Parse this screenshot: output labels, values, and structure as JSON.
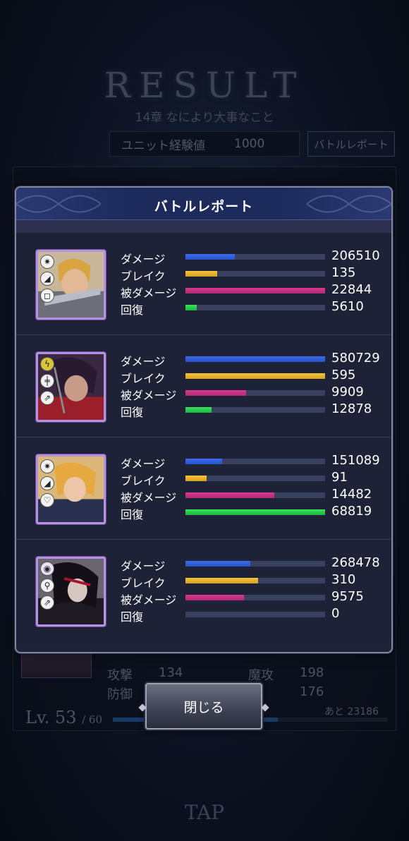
{
  "background": {
    "title": "RESULT",
    "subtitle": "14章 なにより大事なこと",
    "exp_label": "ユニット経験値",
    "exp_value": "1000",
    "report_button": "バトルレポート",
    "stats": [
      {
        "label": "攻撃",
        "value": "134"
      },
      {
        "label": "防御",
        "value": "176"
      },
      {
        "label": "魔攻",
        "value": "198"
      }
    ],
    "level_prefix": "Lv.",
    "level": "53",
    "level_max": "/ 60",
    "remaining": "あと 23186",
    "tap": "TAP"
  },
  "modal": {
    "title": "バトルレポート",
    "stat_labels": {
      "damage": "ダメージ",
      "break": "ブレイク",
      "received": "被ダメージ",
      "heal": "回復"
    },
    "units": [
      {
        "portrait": "blonde-knight",
        "badges": [
          "✷",
          "◢",
          "◻"
        ],
        "damage": "206510",
        "break": "135",
        "received": "22844",
        "heal": "5610"
      },
      {
        "portrait": "dark-haired-warrior",
        "badges": [
          "ϟ",
          "╪",
          "⇗"
        ],
        "damage": "580729",
        "break": "595",
        "received": "9909",
        "heal": "12878"
      },
      {
        "portrait": "blonde-mage",
        "badges": [
          "✷",
          "◢",
          "♡"
        ],
        "damage": "151089",
        "break": "91",
        "received": "14482",
        "heal": "68819"
      },
      {
        "portrait": "dark-figure",
        "badges": [
          "◉",
          "⚲",
          "⇗"
        ],
        "damage": "268478",
        "break": "310",
        "received": "9575",
        "heal": "0"
      }
    ],
    "close_button": "閉じる"
  },
  "colors": {
    "damage": "#3a6cf0",
    "break": "#f4c63a",
    "received": "#d8398f",
    "heal": "#36e25a",
    "portrait_frame": "#b592e0"
  }
}
